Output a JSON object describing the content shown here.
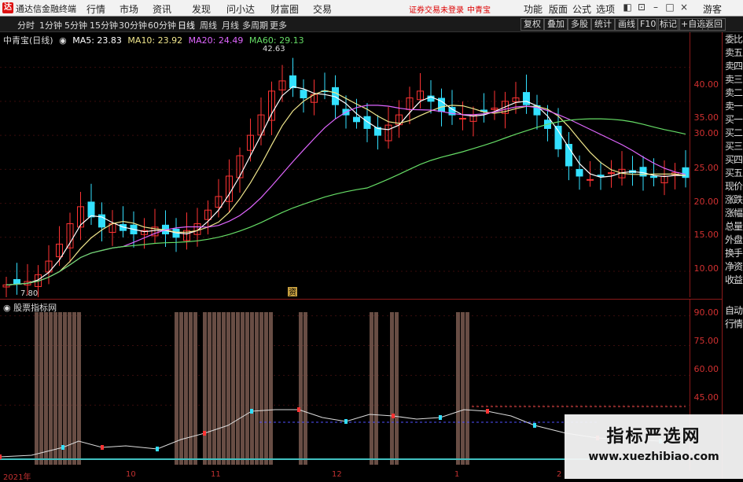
{
  "menubar": {
    "app_name": "通达信金融终端",
    "items": [
      "行情",
      "市场",
      "资讯",
      "发现",
      "问小达",
      "财富圈",
      "交易"
    ],
    "status": "证券交易未登录",
    "stock": "中青宝",
    "right_items": [
      "功能",
      "版面",
      "公式",
      "选项"
    ],
    "login": "游客"
  },
  "toolbar": {
    "periods": [
      "分时",
      "1分钟",
      "5分钟",
      "15分钟",
      "30分钟",
      "60分钟",
      "日线",
      "周线",
      "月线",
      "多周期",
      "更多"
    ],
    "buttons": [
      "复权",
      "叠加",
      "多股",
      "统计",
      "画线",
      "F10",
      "标记",
      "+自选",
      "返回"
    ]
  },
  "main_chart": {
    "title": "中青宝(日线)",
    "ma": [
      {
        "label": "MA5: 23.83",
        "color": "#ffffff"
      },
      {
        "label": "MA10: 23.92",
        "color": "#f0e68c"
      },
      {
        "label": "MA20: 24.49",
        "color": "#e066ff"
      },
      {
        "label": "MA60: 29.13",
        "color": "#66dd66"
      }
    ],
    "high_label": "42.63",
    "low_label": "7.80",
    "marker": "资"
  },
  "sub_chart": {
    "title": "股票指标网"
  },
  "side_panel": [
    "委比",
    "卖五",
    "卖四",
    "卖三",
    "卖二",
    "卖一",
    "买一",
    "买二",
    "买三",
    "买四",
    "买五",
    "现价",
    "涨跌",
    "涨幅",
    "总量",
    "外盘",
    "换手",
    "净资",
    "收益",
    "自动",
    "行情"
  ],
  "x_axis_labels": [
    "2021年",
    "10",
    "11",
    "12",
    "1",
    "2"
  ],
  "watermark": {
    "line1": "指标严选网",
    "line2": "www.xuezhibiao.com"
  },
  "chart_data": [
    {
      "type": "candlestick",
      "title": "中青宝(日线)",
      "y_ticks": [
        "40.00",
        "35.00",
        "30.00",
        "25.00",
        "20.00",
        "15.00",
        "10.00"
      ],
      "ylim": [
        7,
        44
      ],
      "annotations": [
        "42.63",
        "7.80"
      ],
      "series": [
        {
          "name": "MA5",
          "color": "#ffffff"
        },
        {
          "name": "MA10",
          "color": "#f0e68c"
        },
        {
          "name": "MA20",
          "color": "#e066ff"
        },
        {
          "name": "MA60",
          "color": "#66dd66"
        }
      ],
      "close_approx": [
        8.0,
        8.2,
        8.5,
        9.5,
        11.5,
        14.0,
        17.0,
        19.5,
        18.0,
        16.5,
        17.0,
        16.0,
        15.5,
        16.0,
        16.5,
        15.5,
        15.0,
        16.0,
        17.0,
        19.0,
        21.0,
        24.0,
        27.0,
        30.0,
        33.0,
        36.5,
        38.0,
        37.0,
        35.5,
        36.0,
        36.5,
        34.5,
        33.0,
        32.0,
        31.0,
        30.0,
        31.5,
        33.0,
        35.5,
        36.5,
        35.0,
        33.5,
        33.0,
        32.5,
        33.0,
        33.5,
        34.0,
        35.0,
        35.5,
        34.5,
        33.0,
        31.0,
        28.0,
        25.5,
        24.0,
        23.5,
        24.0,
        24.5,
        25.0,
        24.5,
        24.0,
        23.8,
        24.0,
        24.5,
        23.8
      ]
    },
    {
      "type": "bar",
      "title": "股票指标网",
      "y_ticks": [
        "90.00",
        "75.00",
        "60.00",
        "45.00"
      ],
      "ylim": [
        15,
        95
      ]
    }
  ]
}
